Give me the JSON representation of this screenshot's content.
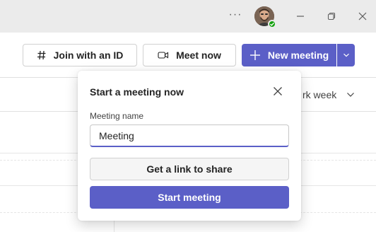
{
  "titlebar": {
    "more_label": "···",
    "icons": [
      "more-icon",
      "avatar",
      "minimize-icon",
      "restore-icon",
      "close-icon"
    ]
  },
  "toolbar": {
    "join_label": "Join with an ID",
    "meet_now_label": "Meet now",
    "new_meeting_label": "New meeting"
  },
  "calendar": {
    "view_partial_label": "rk week"
  },
  "popup": {
    "title": "Start a meeting now",
    "field_label": "Meeting name",
    "input_value": "Meeting",
    "link_button_label": "Get a link to share",
    "start_button_label": "Start meeting"
  },
  "colors": {
    "accent": "#5b5fc7",
    "presence": "#13a10e",
    "titlebar_bg": "#ebebeb"
  }
}
